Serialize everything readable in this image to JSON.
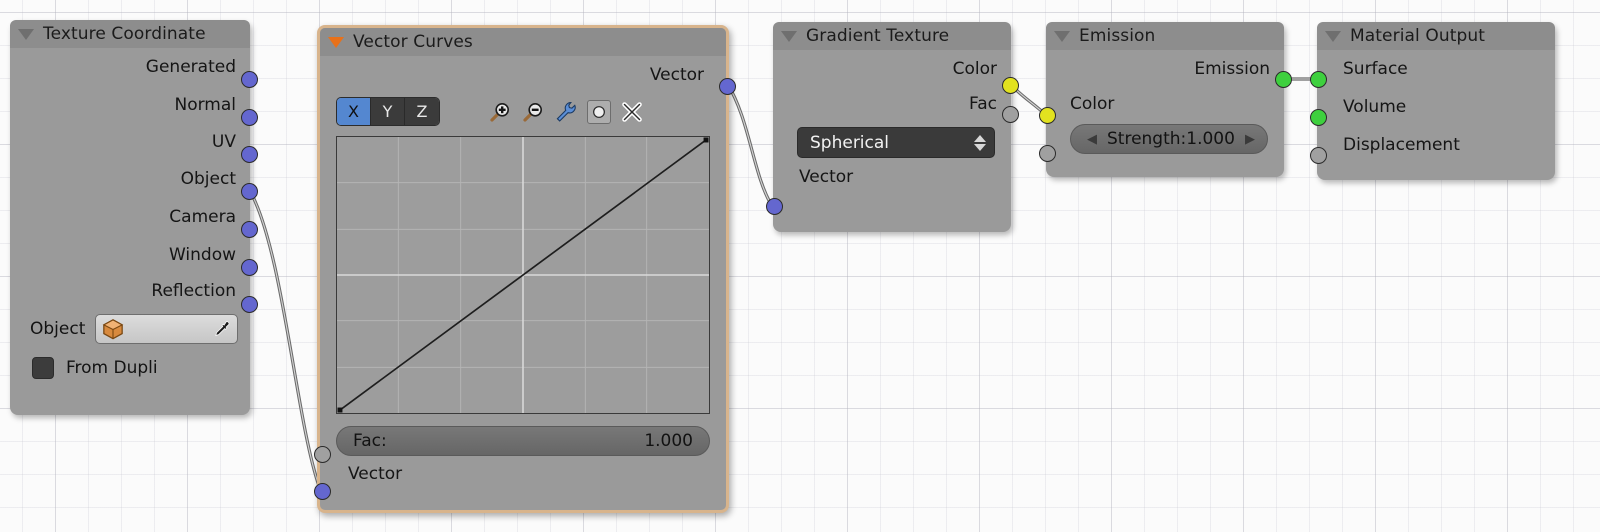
{
  "app": {
    "editor": "blender-shader-node-editor"
  },
  "nodes": {
    "texture_coordinate": {
      "title": "Texture Coordinate",
      "outputs": [
        {
          "label": "Generated",
          "socket": "vector"
        },
        {
          "label": "Normal",
          "socket": "vector"
        },
        {
          "label": "UV",
          "socket": "vector"
        },
        {
          "label": "Object",
          "socket": "vector"
        },
        {
          "label": "Camera",
          "socket": "vector"
        },
        {
          "label": "Window",
          "socket": "vector"
        },
        {
          "label": "Reflection",
          "socket": "vector"
        }
      ],
      "object_field": {
        "label": "Object",
        "value": "",
        "icon": "cube-icon",
        "picker": "eyedropper-icon"
      },
      "from_dupli": {
        "label": "From Dupli",
        "checked": false
      }
    },
    "vector_curves": {
      "title": "Vector Curves",
      "active": true,
      "outputs": [
        {
          "label": "Vector",
          "socket": "vector"
        }
      ],
      "axis_tabs": [
        "X",
        "Y",
        "Z"
      ],
      "axis_selected": "X",
      "tools": [
        "zoom-in-icon",
        "zoom-out-icon",
        "wrench-icon",
        "clipping-toggle-icon",
        "delete-icon"
      ],
      "fac": {
        "label": "Fac:",
        "value": "1.000"
      },
      "inputs": [
        {
          "label": "Vector",
          "socket": "vector"
        }
      ]
    },
    "gradient_texture": {
      "title": "Gradient Texture",
      "outputs": [
        {
          "label": "Color",
          "socket": "color"
        },
        {
          "label": "Fac",
          "socket": "gray"
        }
      ],
      "type_dropdown": {
        "value": "Spherical"
      },
      "inputs": [
        {
          "label": "Vector",
          "socket": "vector"
        }
      ]
    },
    "emission": {
      "title": "Emission",
      "outputs": [
        {
          "label": "Emission",
          "socket": "shader"
        }
      ],
      "inputs": [
        {
          "label": "Color",
          "socket": "color"
        }
      ],
      "strength": {
        "label": "Strength:",
        "value": "1.000"
      }
    },
    "material_output": {
      "title": "Material Output",
      "inputs": [
        {
          "label": "Surface",
          "socket": "shader"
        },
        {
          "label": "Volume",
          "socket": "shader"
        },
        {
          "label": "Displacement",
          "socket": "gray"
        }
      ]
    }
  },
  "colors": {
    "vector_socket": "#6467cf",
    "color_socket": "#e2e21f",
    "shader_socket": "#3ed03e",
    "gray_socket": "#a0a0a0",
    "node_body": "#9a9a9a",
    "node_header": "#8d8d8d",
    "active_border": "#d8b48c",
    "tab_selected": "#5487d0"
  }
}
